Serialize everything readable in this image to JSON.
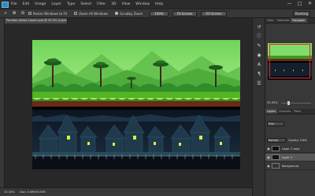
{
  "menu": [
    "File",
    "Edit",
    "Image",
    "Layer",
    "Type",
    "Select",
    "Filter",
    "3D",
    "View",
    "Window",
    "Help"
  ],
  "window_controls": [
    "—",
    "□",
    "✕"
  ],
  "options": {
    "resize_windows": "Resize Windows to Fit",
    "zoom_all_windows": "Zoom All Windows",
    "scrubby_zoom": "Scrubby Zoom",
    "btn_100": "100%",
    "btn_fit": "Fit Screen",
    "btn_fill": "Fill Screen",
    "workspace": "Painting"
  },
  "document": {
    "tab_title": "Parallax-Game-Layers.psd @ 33.3% (Layer 2, RGB/8#) *",
    "zoom": "33.33%",
    "doc_size": "Doc: 4.69M/6.55M"
  },
  "panels": {
    "top_tabs": [
      "Color",
      "Swatches",
      "Navigator"
    ],
    "top_active_index": 2,
    "nav_zoom": "33.33%",
    "layers_tabs": [
      "Layers",
      "Channels",
      "Paths"
    ],
    "layers_active_index": 0,
    "kind": "Kind",
    "blend": "Normal",
    "opacity": "Opacity: 100%",
    "layers": [
      {
        "name": "Layer 1 copy",
        "selected": false
      },
      {
        "name": "Layer 2",
        "selected": true
      },
      {
        "name": "Background",
        "selected": false
      }
    ]
  },
  "colors": {
    "sky": "#7fdd6a",
    "grass": "#4ca820",
    "dirt": "#6b2a17",
    "night": "#0f1b2a",
    "window_glow": "#d9ee3a"
  }
}
